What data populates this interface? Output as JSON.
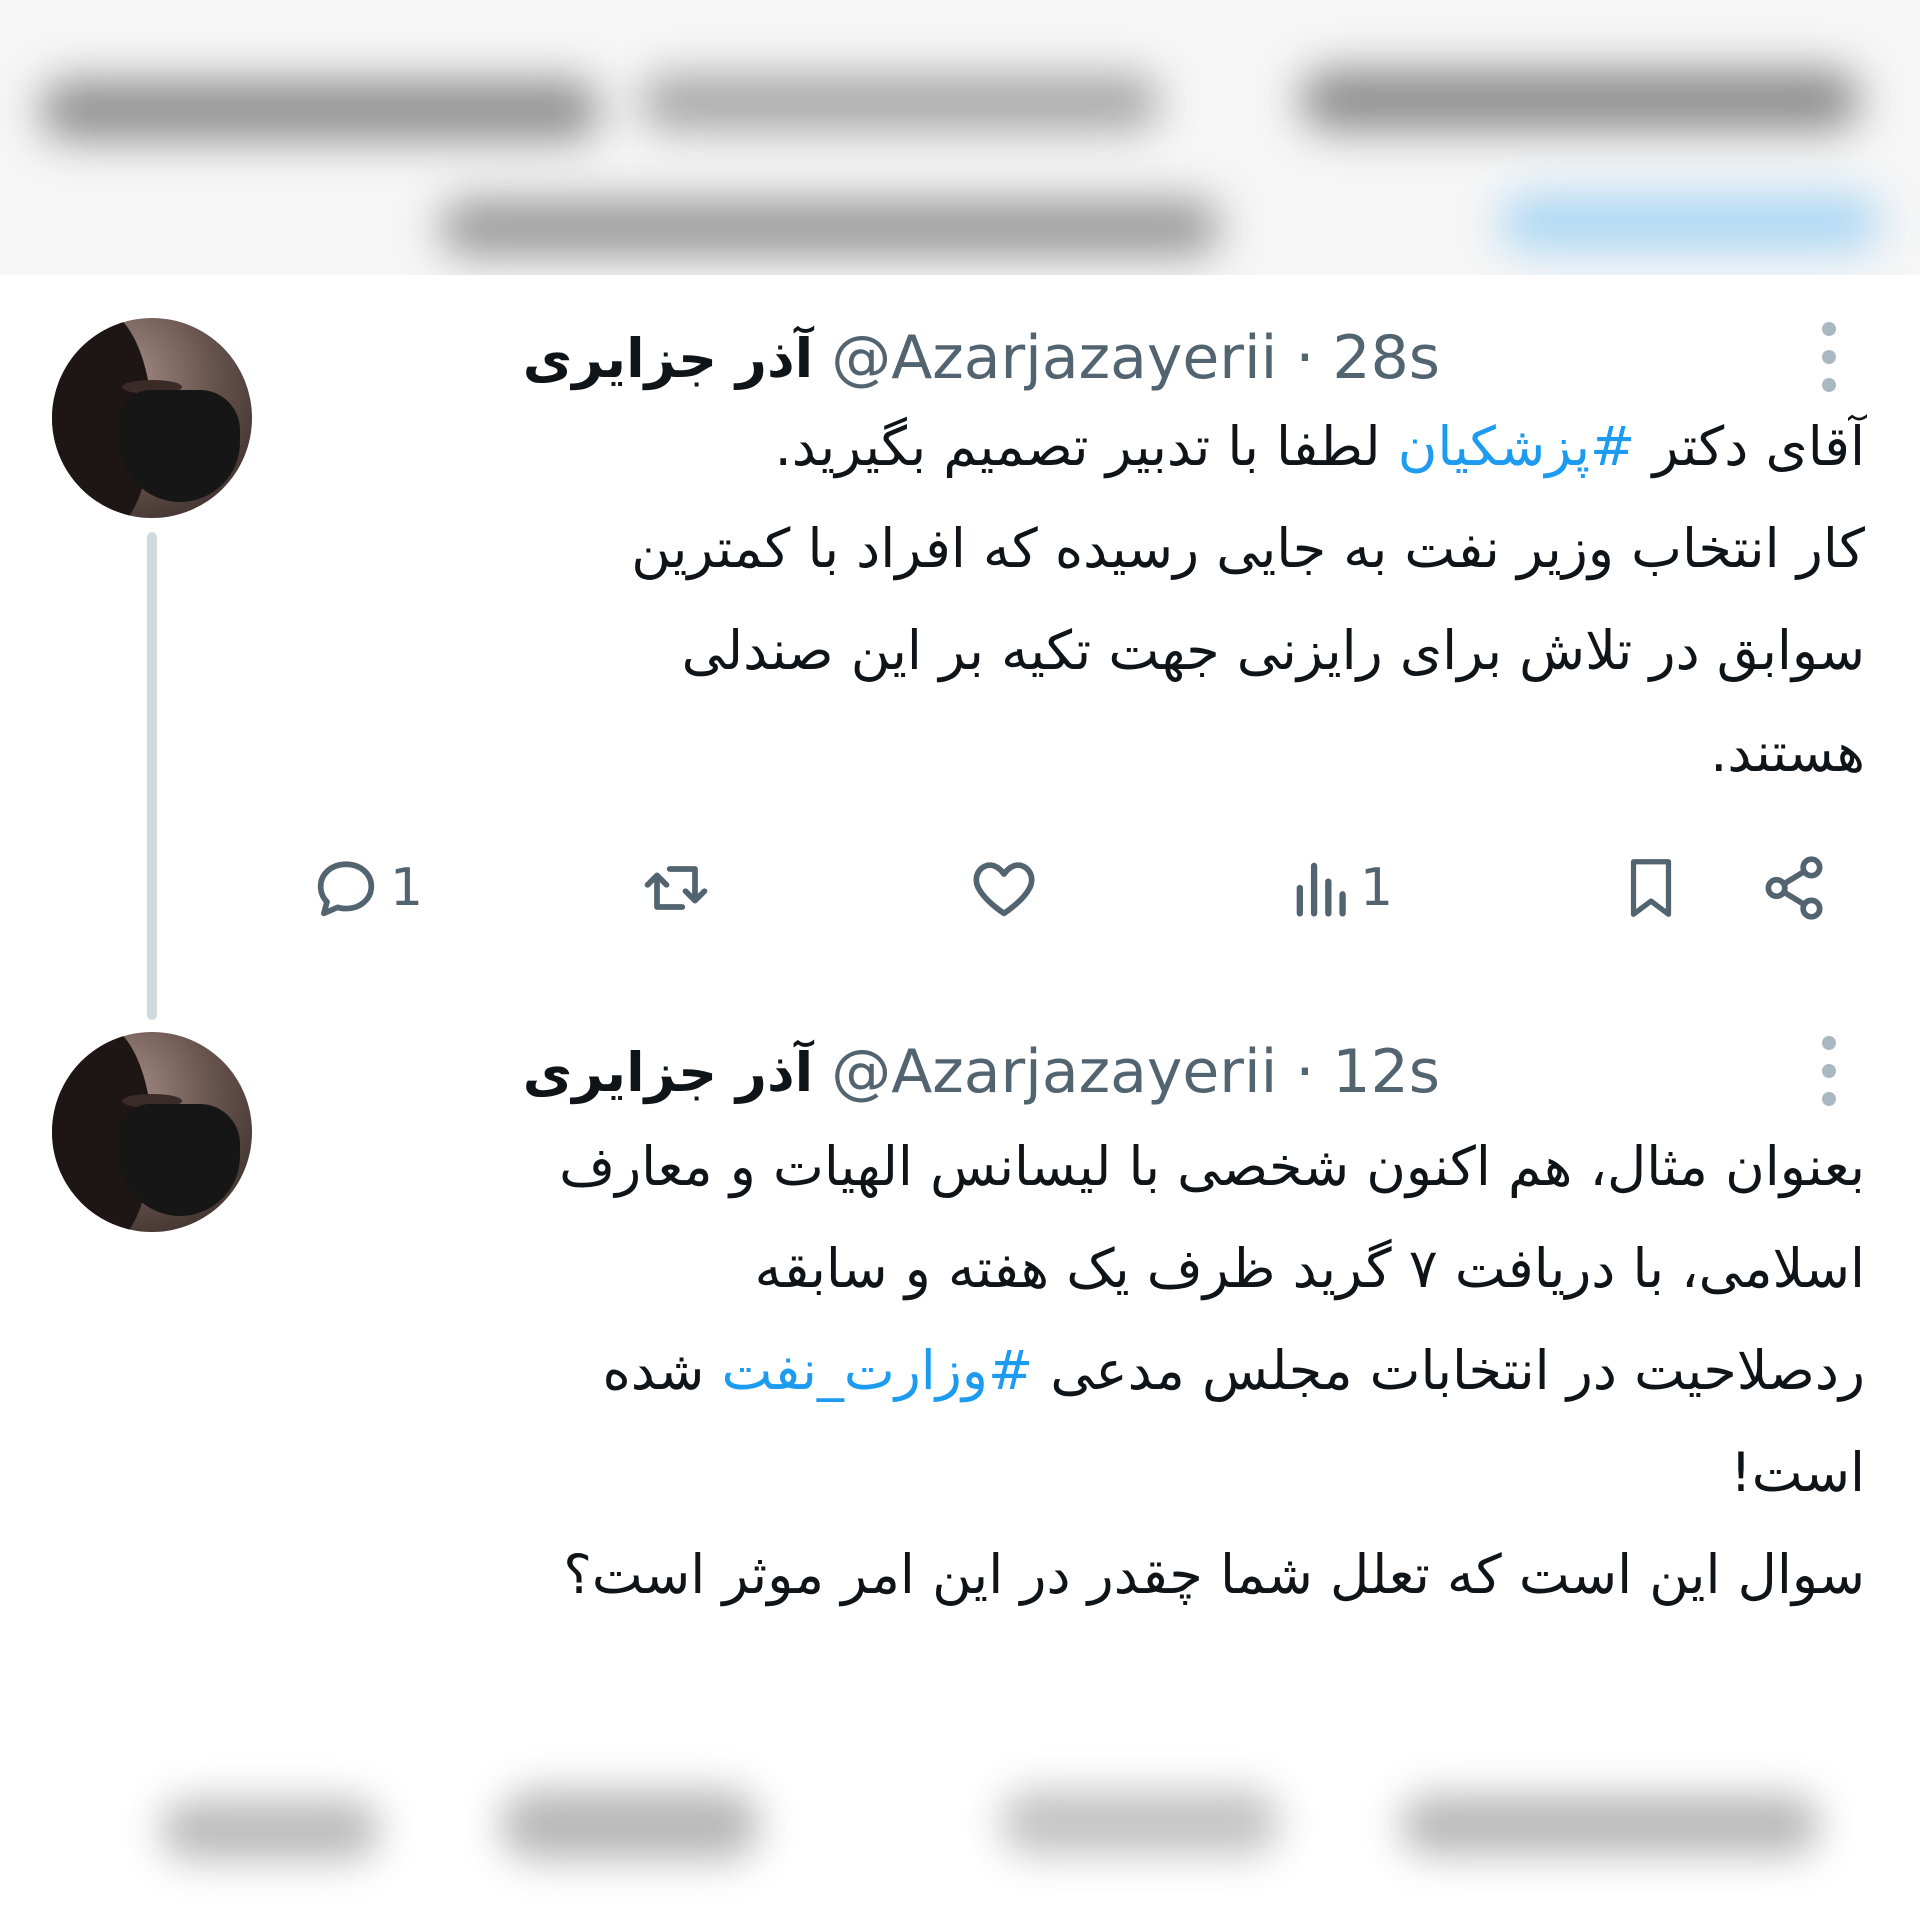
{
  "colors": {
    "accent": "#1d9bf0",
    "muted": "#536471",
    "text": "#0f1419",
    "thread_line": "#cfd9de"
  },
  "tweets": [
    {
      "name": "آذر جزایری",
      "handle": "@Azarjazayerii",
      "separator": "·",
      "time": "28s",
      "lines": [
        {
          "before": "آقای دکتر ",
          "hashtag": "#پزشکیان",
          "after": " لطفا با تدبیر تصمیم بگیرید."
        },
        {
          "before": "کار انتخاب وزیر نفت به جایی رسیده که افراد با کمترین",
          "hashtag": "",
          "after": ""
        },
        {
          "before": "سوابق در تلاش برای رایزنی جهت تکیه بر این صندلی",
          "hashtag": "",
          "after": ""
        },
        {
          "before": "هستند.",
          "hashtag": "",
          "after": ""
        }
      ],
      "actions": {
        "reply_count": "1",
        "retweet_count": "",
        "like_count": "",
        "views_count": "1",
        "icons": [
          "reply-icon",
          "retweet-icon",
          "like-icon",
          "views-icon",
          "bookmark-icon",
          "share-icon"
        ]
      }
    },
    {
      "name": "آذر جزایری",
      "handle": "@Azarjazayerii",
      "separator": "·",
      "time": "12s",
      "lines": [
        {
          "before": "بعنوان مثال، هم اکنون شخصی با لیسانس الهیات و معارف",
          "hashtag": "",
          "after": ""
        },
        {
          "before": "اسلامی، با دریافت ۷ گرید ظرف یک هفته و سابقه",
          "hashtag": "",
          "after": ""
        },
        {
          "before": "ردصلاحیت در انتخابات مجلس مدعی ",
          "hashtag": "#وزارت_نفت",
          "after": " شده"
        },
        {
          "before": "است!",
          "hashtag": "",
          "after": ""
        },
        {
          "before": "سوال این است که تعلل شما چقدر در این امر موثر است؟",
          "hashtag": "",
          "after": ""
        }
      ]
    }
  ]
}
